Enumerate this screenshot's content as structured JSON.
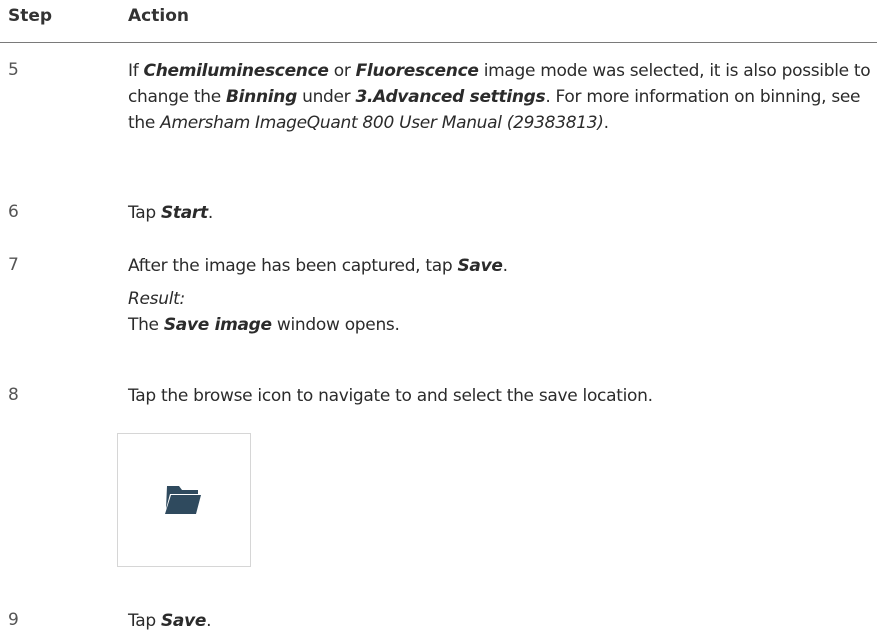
{
  "header": {
    "step": "Step",
    "action": "Action"
  },
  "rows": [
    {
      "num": "5",
      "p1": "If ",
      "b1": "Chemiluminescence",
      "p2": " or ",
      "b2": "Fluorescence",
      "p3": " image mode was selected, it is also possible to change the ",
      "b3": "Binning",
      "p4": " under ",
      "b4": "3.Advanced settings",
      "p5": ". For more information on binning, see the ",
      "i1": "Amersham ImageQuant 800 User Manual (29383813)",
      "p6": "."
    },
    {
      "num": "6",
      "p1": "Tap ",
      "b1": "Start",
      "p2": "."
    },
    {
      "num": "7",
      "p1": "After the image has been captured, tap ",
      "b1": "Save",
      "p2": ".",
      "result_label": "Result:",
      "r1": "The ",
      "rb": "Save image",
      "r2": " window opens."
    },
    {
      "num": "8",
      "text": "Tap the browse icon to navigate to and select the save location.",
      "icon": "folder-open-icon"
    },
    {
      "num": "9",
      "p1": "Tap ",
      "b1": "Save",
      "p2": "."
    }
  ],
  "colors": {
    "icon": "#2f4a5e",
    "rule": "#7a7a7a",
    "text": "#2b2b2b"
  }
}
